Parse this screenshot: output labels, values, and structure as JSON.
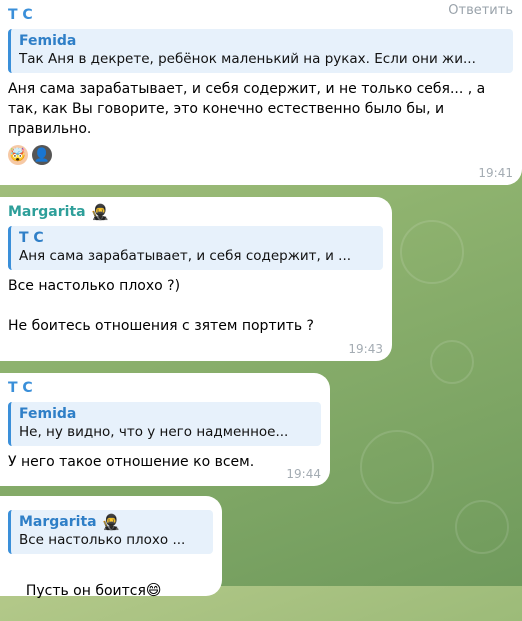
{
  "messages": [
    {
      "sender": "Т С",
      "action": "Ответить",
      "reply": {
        "name": "Femida",
        "text": "Так Аня в декрете, ребёнок маленький на руках. Если они жи..."
      },
      "text": "Аня сама зарабатывает, и себя содержит, и не только себя... , а так, как Вы говорите, это конечно естественно было бы, и правильно.",
      "reactions": [
        {
          "icon": "exploding-head-emoji",
          "glyph": "🤯"
        },
        {
          "icon": "avatar-reaction",
          "glyph": "👤"
        }
      ],
      "time": "19:41"
    },
    {
      "sender": "Margarita",
      "sender_badge": "ninja-emoji",
      "reply": {
        "name": "Т С",
        "text": "Аня сама зарабатывает, и себя содержит, и ..."
      },
      "text": "Все настолько плохо ?)\n\nНе боитесь отношения с зятем портить ?",
      "time": "19:43"
    },
    {
      "sender": "Т С",
      "reply": {
        "name": "Femida",
        "text": "Не, ну видно, что у него надменное..."
      },
      "text": "У него такое отношение ко всем.",
      "time": "19:44"
    },
    {
      "reply": {
        "name": "Margarita",
        "name_badge": "ninja-emoji",
        "text": "Все настолько плохо ..."
      },
      "text": "Пусть он боится",
      "text_emoji": "😄"
    }
  ],
  "colors": {
    "sender_tc": "#3a8fd9",
    "sender_margarita": "#2e9f9a",
    "reply_bar": "#3a8fd9",
    "time": "#a4acb3"
  }
}
